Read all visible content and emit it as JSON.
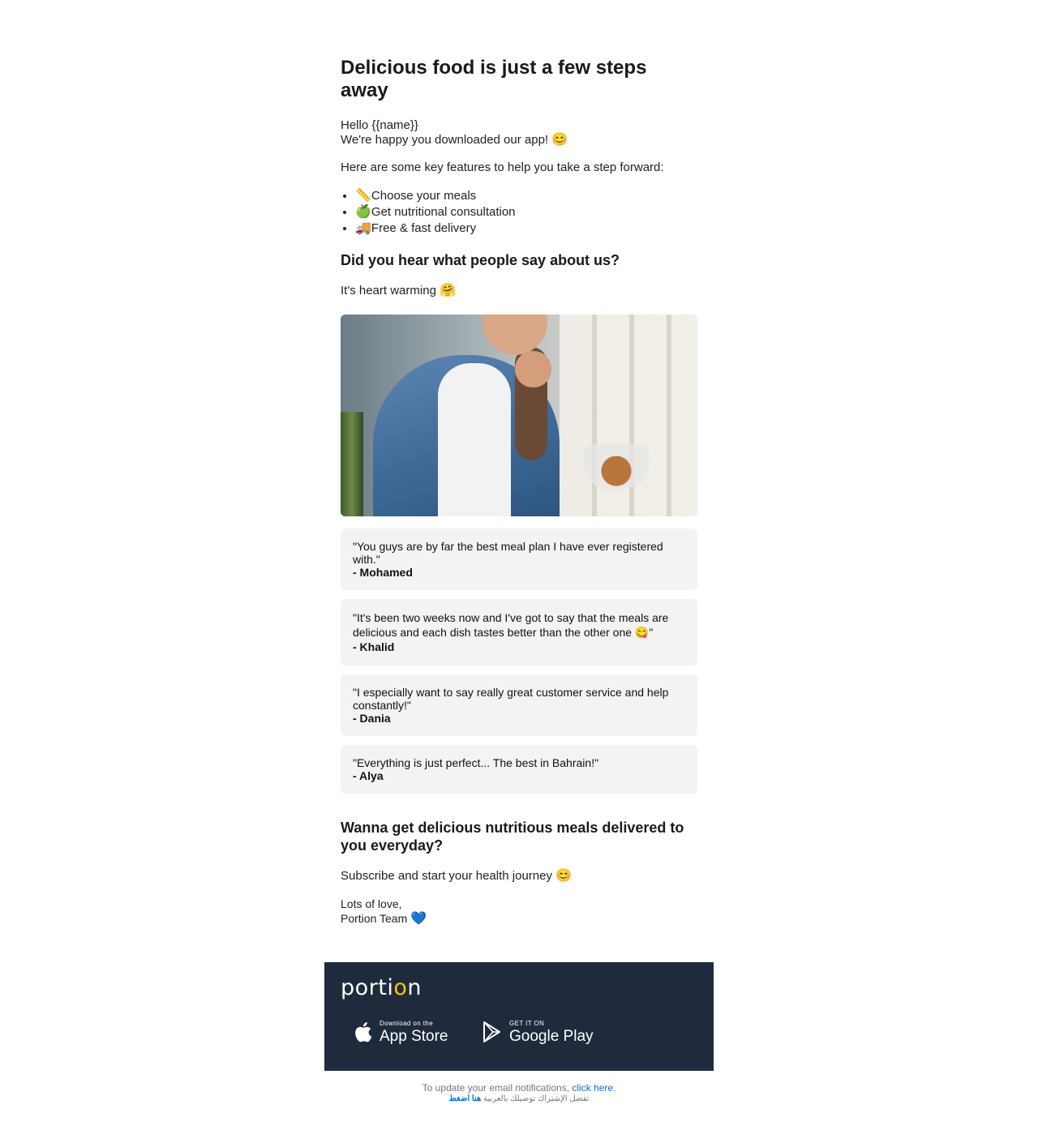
{
  "header": {
    "title": "Delicious food is just a few steps away"
  },
  "intro": {
    "greeting": "Hello {{name}}",
    "happy": "We're happy you downloaded our app!",
    "happy_emoji": "😊",
    "features_intro": "Here are some key features to help you take a step forward:"
  },
  "features": [
    {
      "emoji": "📏",
      "label": "Choose your meals"
    },
    {
      "emoji": "🍏",
      "label": "Get nutritional consultation"
    },
    {
      "emoji": "🚚",
      "label": "Free & fast delivery"
    }
  ],
  "testimonials_section": {
    "heading": "Did you hear what people say about us?",
    "sub": "It's heart warming",
    "sub_emoji": "🤗"
  },
  "testimonials": [
    {
      "quote": "\"You guys are by far the best meal plan I have ever registered with.\"",
      "author": "- Mohamed"
    },
    {
      "quote": "\"It's been two weeks now and I've got to say that the meals are delicious and each dish tastes better than the other one 😋\"",
      "author": "- Khalid"
    },
    {
      "quote": "\"I especially want to say really great customer service and help constantly!\"",
      "author": "- Dania"
    },
    {
      "quote": "\"Everything is just perfect... The best in Bahrain!\"",
      "author": "- Alya"
    }
  ],
  "cta": {
    "heading": "Wanna get delicious nutritious meals delivered to you everyday?",
    "sub": "Subscribe and start your health journey",
    "sub_emoji": "😊"
  },
  "signoff": {
    "line1": "Lots of love,",
    "line2": "Portion Team",
    "emoji": "💙"
  },
  "footer": {
    "logo_pre": "porti",
    "logo_o": "o",
    "logo_post": "n",
    "app_store_small": "Download on the",
    "app_store_big": "App Store",
    "google_small": "GET IT ON",
    "google_big": "Google Play",
    "bg_color": "#1f2b3d",
    "accent_color": "#f5c400"
  },
  "legal": {
    "text": "To update your email notifications,",
    "link": "click here",
    "period": ".",
    "arabic_text": "تفضل الإشتراك توصيلك بالعربية",
    "arabic_link": "هنا اضغط"
  }
}
